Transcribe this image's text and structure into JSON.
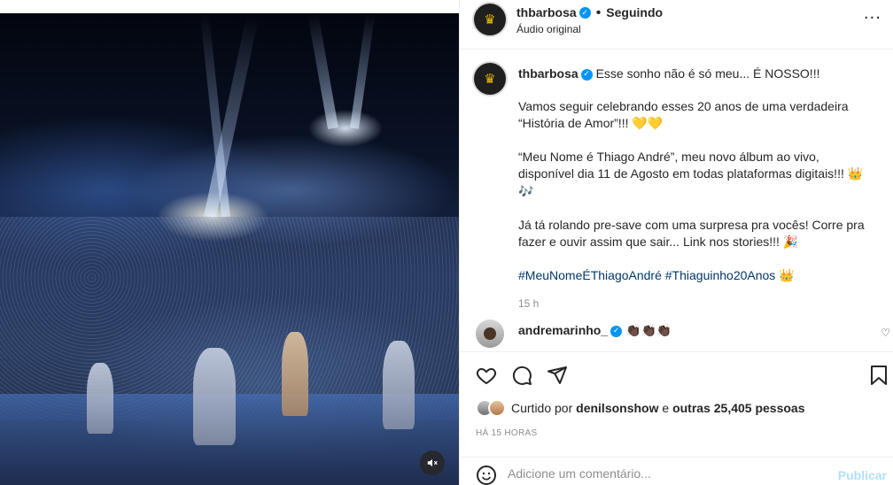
{
  "post": {
    "author": "thbarbosa",
    "following_label": "Seguindo",
    "audio_label": "Áudio original",
    "more_icon": "more-horizontal-icon",
    "caption": {
      "line1": "Esse sonho não é só meu... É NOSSO!!!",
      "para2": "Vamos seguir celebrando esses 20 anos de uma verdadeira “História de Amor”!!!",
      "para2_emoji": "💛💛",
      "para3": "“Meu Nome é Thiago André”, meu novo álbum ao vivo, disponível dia 11 de Agosto em todas plataformas digitais!!!",
      "para3_emoji": "👑🎶",
      "para4": "Já tá rolando pre-save com uma surpresa pra vocês! Corre pra fazer e ouvir assim que sair... Link nos stories!!!",
      "para4_emoji": "🎉",
      "hashtag1": "#MeuNomeÉThiagoAndré",
      "hashtag2": "#Thiaguinho20Anos",
      "hashtag_emoji": "👑",
      "time": "15 h"
    },
    "comment": {
      "user": "andremarinho_",
      "text": "👏🏿👏🏿👏🏿"
    },
    "likes": {
      "prefix": "Curtido por",
      "user": "denilsonshow",
      "connector": "e",
      "others": "outras 25,405 pessoas"
    },
    "posted_ago": "HÁ 15 HORAS",
    "add_comment": {
      "placeholder": "Adicione um comentário...",
      "publish_label": "Publicar"
    }
  },
  "colors": {
    "verified": "#0095f6",
    "link": "#00376b",
    "publish_disabled": "#b2dffc",
    "crown": "#e6b800"
  }
}
